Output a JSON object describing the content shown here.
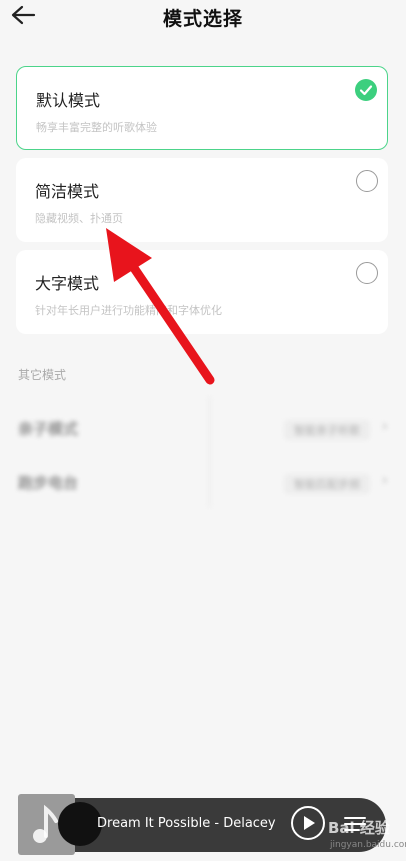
{
  "header": {
    "title": "模式选择",
    "back_icon": "arrow-left-icon"
  },
  "modes": [
    {
      "title": "默认模式",
      "desc": "畅享丰富完整的听歌体验",
      "selected": true
    },
    {
      "title": "简洁模式",
      "desc": "隐藏视频、扑通页",
      "selected": false
    },
    {
      "title": "大字模式",
      "desc": "针对年长用户进行功能精简和字体优化",
      "selected": false
    }
  ],
  "other_modes": {
    "label": "其它模式",
    "items": [
      {
        "name": "亲子模式",
        "value": "智能亲子听歌"
      },
      {
        "name": "跑步电台",
        "value": "智能匹配步频"
      }
    ]
  },
  "player": {
    "song": "Dream It Possible - Delacey",
    "play_icon": "play-icon",
    "playlist_icon": "playlist-icon"
  },
  "watermark": {
    "text": "Bai 经验",
    "sub": "jingyan.baidu.com"
  },
  "colors": {
    "accent": "#3ccf7e",
    "arrow": "#e8141c"
  }
}
